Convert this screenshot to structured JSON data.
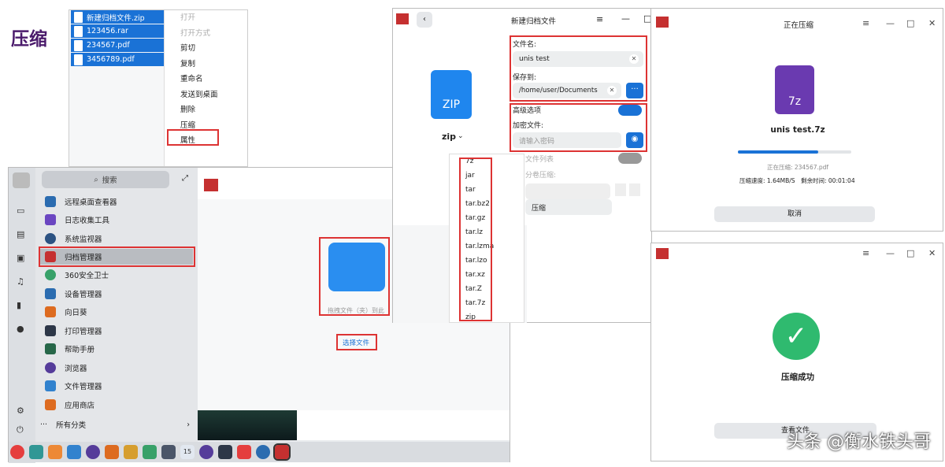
{
  "heading": "压缩",
  "files": [
    "新建归档文件.zip",
    "123456.rar",
    "234567.pdf",
    "3456789.pdf"
  ],
  "context_menu": [
    "打开",
    "打开方式",
    "剪切",
    "复制",
    "重命名",
    "发送到桌面",
    "删除",
    "压缩",
    "属性"
  ],
  "launcher": {
    "search": "搜索",
    "items": [
      "远程桌面查看器",
      "日志收集工具",
      "系统监视器",
      "归档管理器",
      "360安全卫士",
      "设备管理器",
      "向日葵",
      "打印管理器",
      "帮助手册",
      "浏览器",
      "文件管理器",
      "应用商店"
    ],
    "all_categories": "所有分类",
    "drop_hint": "拖拽文件（夹）到此",
    "select_file": "选择文件",
    "clock": "15"
  },
  "new_archive": {
    "title": "新建归档文件",
    "filename_label": "文件名:",
    "filename": "unis test",
    "save_to_label": "保存到:",
    "save_to": "/home/user/Documents",
    "advanced_label": "高级选项",
    "encrypt_label": "加密文件:",
    "password_placeholder": "请输入密码",
    "file_list_label": "文件列表",
    "split_label": "分卷压缩:",
    "compress_btn": "压缩",
    "format": "zip",
    "icon_text": "ZIP",
    "formats": [
      "7z",
      "jar",
      "tar",
      "tar.bz2",
      "tar.gz",
      "tar.lz",
      "tar.lzma",
      "tar.lzo",
      "tar.xz",
      "tar.Z",
      "tar.7z",
      "zip"
    ]
  },
  "compressing": {
    "title": "正在压缩",
    "filename": "unis test.7z",
    "icon_text": "7z",
    "progress": 0.71,
    "current": "正在压缩: 234567.pdf",
    "speed": "压缩速度: 1.64MB/S",
    "remaining": "剩余时间: 00:01:04",
    "cancel": "取消"
  },
  "success": {
    "message": "压缩成功",
    "view_btn": "查看文件"
  },
  "watermark": "头条 @衡水铁头哥"
}
